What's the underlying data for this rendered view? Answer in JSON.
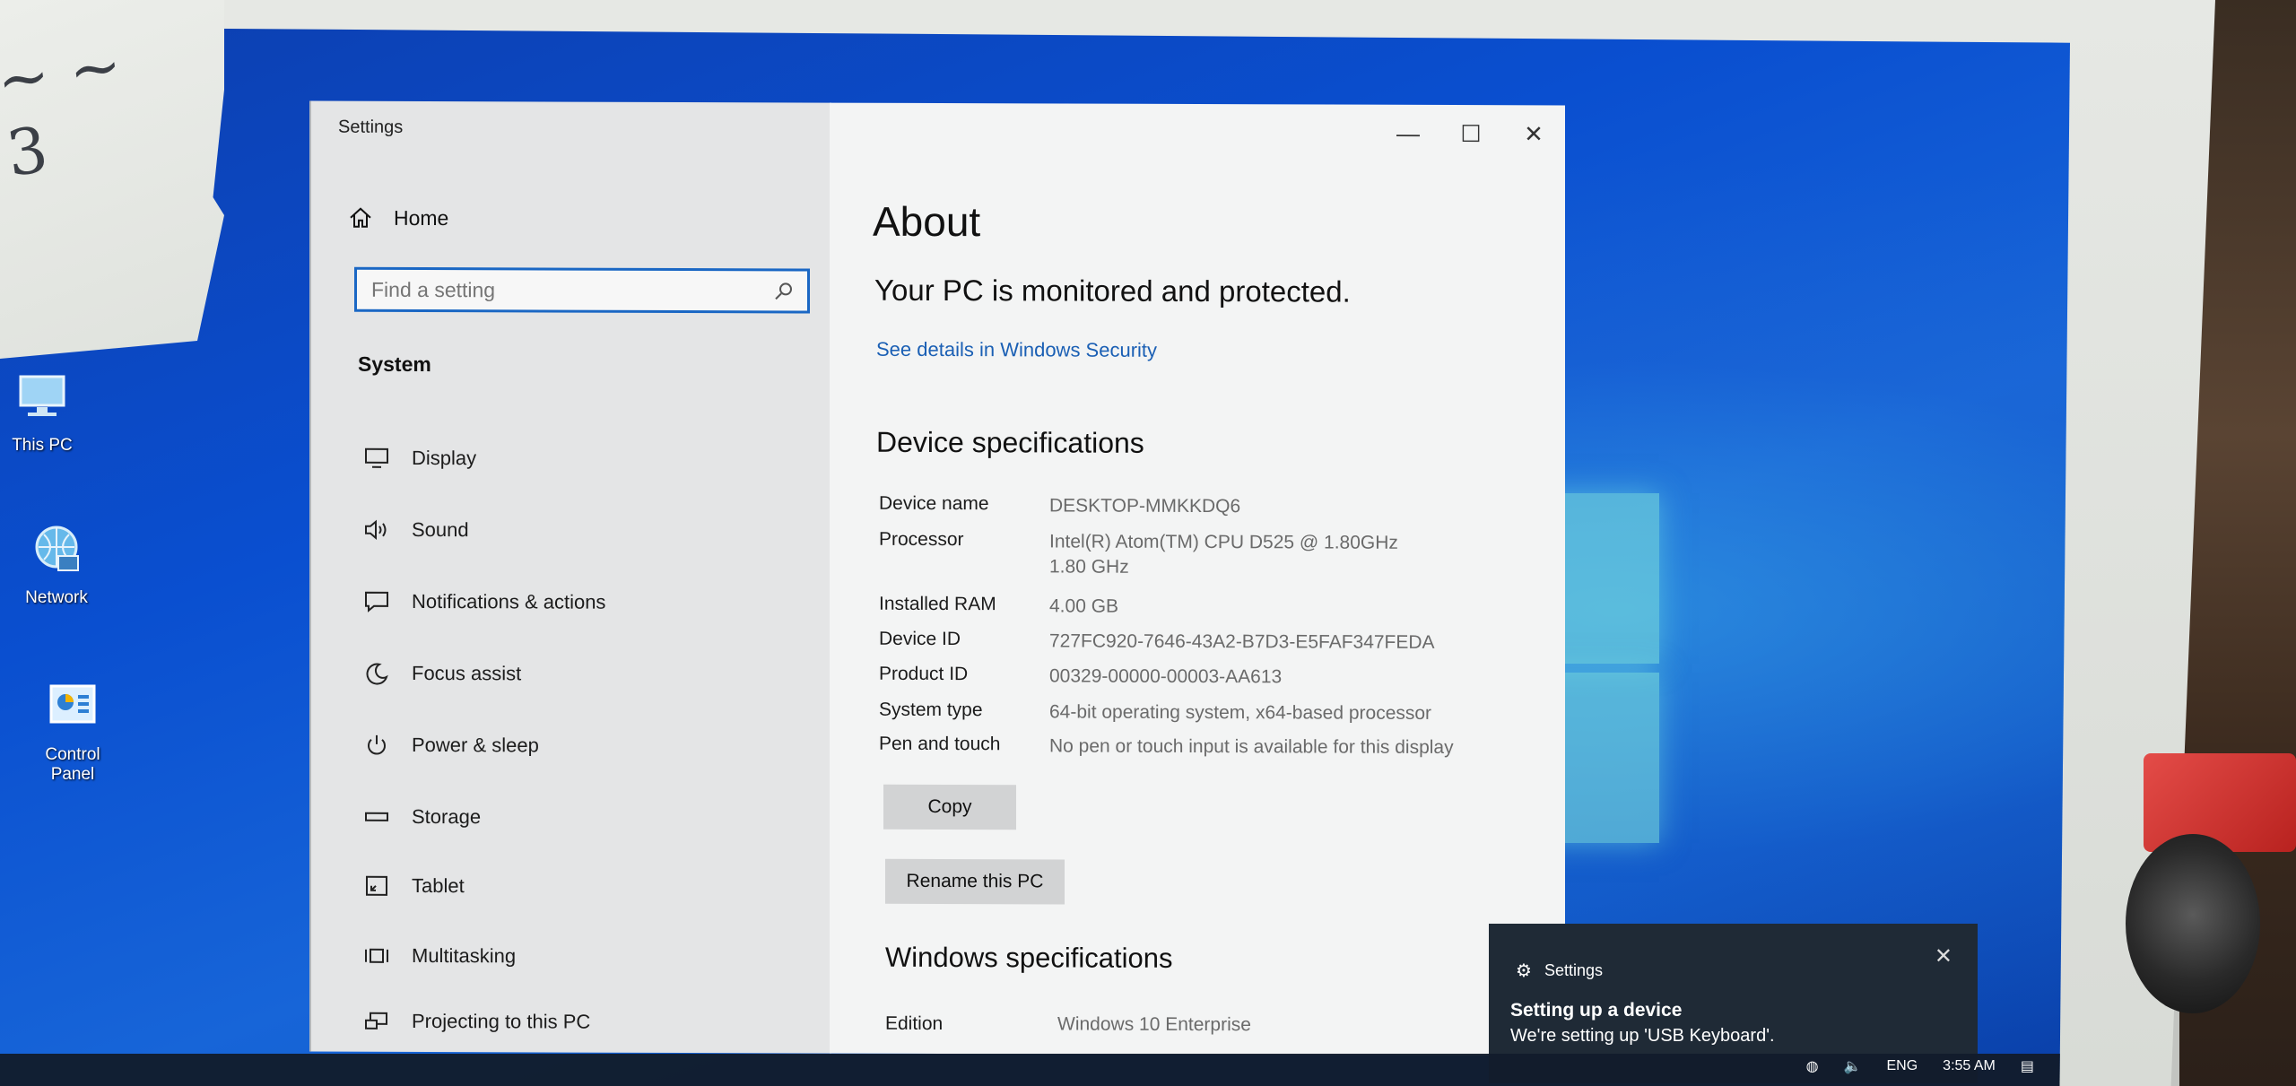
{
  "desktop": {
    "icons": [
      {
        "label": "This PC"
      },
      {
        "label": "Network"
      },
      {
        "label": "Control Panel"
      }
    ]
  },
  "window": {
    "title": "Settings",
    "controls": {
      "minimize": "—",
      "maximize": "☐",
      "close": "✕"
    }
  },
  "sidebar": {
    "home_label": "Home",
    "search_placeholder": "Find a setting",
    "section_title": "System",
    "items": [
      {
        "label": "Display",
        "icon": "display-icon"
      },
      {
        "label": "Sound",
        "icon": "sound-icon"
      },
      {
        "label": "Notifications & actions",
        "icon": "notifications-icon"
      },
      {
        "label": "Focus assist",
        "icon": "focus-assist-icon"
      },
      {
        "label": "Power & sleep",
        "icon": "power-icon"
      },
      {
        "label": "Storage",
        "icon": "storage-icon"
      },
      {
        "label": "Tablet",
        "icon": "tablet-icon"
      },
      {
        "label": "Multitasking",
        "icon": "multitasking-icon"
      },
      {
        "label": "Projecting to this PC",
        "icon": "projecting-icon"
      }
    ]
  },
  "about": {
    "heading": "About",
    "protection": "Your PC is monitored and protected.",
    "security_link": "See details in Windows Security",
    "device_specs_heading": "Device specifications",
    "specs": [
      {
        "key": "Device name",
        "value": "DESKTOP-MMKKDQ6"
      },
      {
        "key": "Processor",
        "value": "Intel(R) Atom(TM) CPU D525   @ 1.80GHz   1.80 GHz"
      },
      {
        "key": "Installed RAM",
        "value": "4.00 GB"
      },
      {
        "key": "Device ID",
        "value": "727FC920-7646-43A2-B7D3-E5FAF347FEDA"
      },
      {
        "key": "Product ID",
        "value": "00329-00000-00003-AA613"
      },
      {
        "key": "System type",
        "value": "64-bit operating system, x64-based processor"
      },
      {
        "key": "Pen and touch",
        "value": "No pen or touch input is available for this display"
      }
    ],
    "copy_label": "Copy",
    "rename_label": "Rename this PC",
    "windows_specs_heading": "Windows specifications",
    "edition_key": "Edition",
    "edition_value": "Windows 10 Enterprise"
  },
  "toast": {
    "app": "Settings",
    "title": "Setting up a device",
    "message": "We're setting up 'USB Keyboard'.",
    "close": "✕"
  },
  "taskbar": {
    "language": "ENG",
    "time": "3:55 AM"
  },
  "colors": {
    "accent": "#1a67c4",
    "link": "#1a5fb4",
    "toast_bg": "#1f2a36"
  }
}
